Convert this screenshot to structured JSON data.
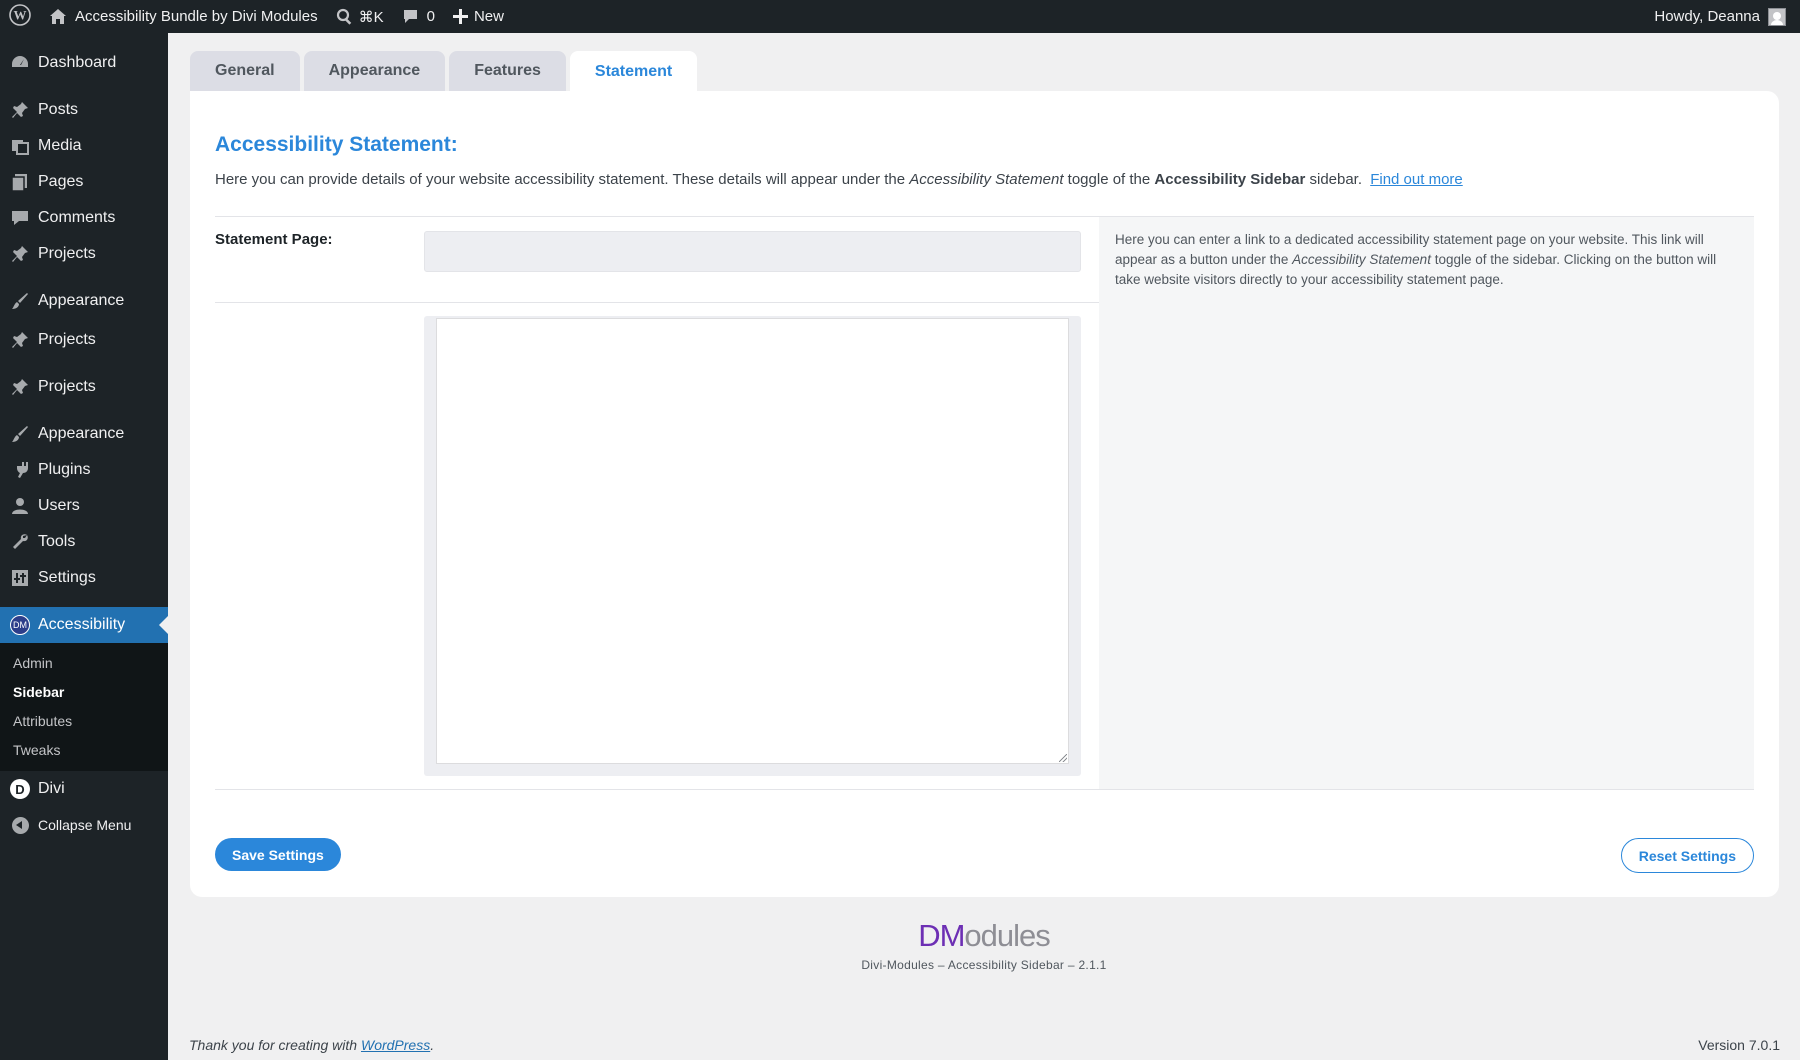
{
  "adminbar": {
    "site_name": "Accessibility Bundle by Divi Modules",
    "search_shortcut": "⌘K",
    "comments_count": "0",
    "new_label": "New",
    "howdy": "Howdy, Deanna"
  },
  "sidebar": {
    "dashboard": "Dashboard",
    "posts": "Posts",
    "media": "Media",
    "pages": "Pages",
    "comments": "Comments",
    "projects1": "Projects",
    "appearance1": "Appearance",
    "projects2": "Projects",
    "projects3": "Projects",
    "appearance2": "Appearance",
    "plugins": "Plugins",
    "users": "Users",
    "tools": "Tools",
    "settings": "Settings",
    "accessibility": "Accessibility",
    "accessibility_badge": "DM",
    "submenu": {
      "admin": "Admin",
      "sidebar": "Sidebar",
      "attributes": "Attributes",
      "tweaks": "Tweaks"
    },
    "divi": "Divi",
    "divi_badge": "D",
    "collapse": "Collapse Menu"
  },
  "tabs": {
    "general": "General",
    "appearance": "Appearance",
    "features": "Features",
    "statement": "Statement"
  },
  "panel": {
    "title": "Accessibility Statement:",
    "intro_1": "Here you can provide details of your website accessibility statement. These details will appear under the ",
    "intro_em": "Accessibility Statement",
    "intro_2": " toggle of the ",
    "intro_strong": "Accessibility Sidebar",
    "intro_3": " sidebar.",
    "find_out_more": "Find out more",
    "statement_label": "Statement Page:",
    "statement_value": "",
    "help_1": "Here you can enter a link to a dedicated accessibility statement page on your website. This link will appear as a button under the ",
    "help_em": "Accessibility Statement",
    "help_2": " toggle of the sidebar. Clicking on the button will take website visitors directly to your accessibility statement page.",
    "editor_value": "",
    "save": "Save Settings",
    "reset": "Reset Settings"
  },
  "brand": {
    "logo_dm": "DM",
    "logo_rest": "odules",
    "subtitle": "Divi-Modules – Accessibility Sidebar – 2.1.1"
  },
  "footer": {
    "thanks_prefix": "Thank you for creating with ",
    "wordpress_link": "WordPress",
    "thanks_suffix": ".",
    "version": "Version 7.0.1"
  }
}
